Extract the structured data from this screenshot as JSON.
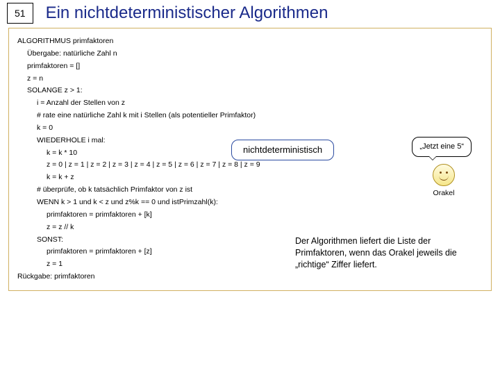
{
  "slide_number": "51",
  "title": "Ein nichtdeterministischer Algorithmen",
  "algo": {
    "l01": "ALGORITHMUS primfaktoren",
    "l02": "Übergabe: natürliche Zahl n",
    "l03": "primfaktoren = []",
    "l04": "z = n",
    "l05": "SOLANGE z > 1:",
    "l06": "i = Anzahl der Stellen von z",
    "l07": "# rate eine natürliche Zahl k mit i Stellen (als potentieller Primfaktor)",
    "l08": "k = 0",
    "l09": "WIEDERHOLE i mal:",
    "l10": "k = k * 10",
    "l11": "z = 0 | z = 1 | z = 2 | z = 3 | z = 4 | z = 5 | z = 6 | z = 7 | z = 8 | z = 9",
    "l12": "k = k + z",
    "l13": "# überprüfe, ob k tatsächlich Primfaktor von z ist",
    "l14": "WENN k > 1 und k < z und z%k == 0 und istPrimzahl(k):",
    "l15": "primfaktoren = primfaktoren + [k]",
    "l16": "z = z // k",
    "l17": "SONST:",
    "l18": "primfaktoren = primfaktoren + [z]",
    "l19": "z = 1",
    "l20": "Rückgabe: primfaktoren"
  },
  "nondet_label": "nichtdeterministisch",
  "speech": "„Jetzt eine 5“",
  "orakel": "Orakel",
  "explanation": "Der Algorithmen liefert die Liste der Primfaktoren, wenn das Orakel jeweils die „richtige“ Ziffer liefert."
}
